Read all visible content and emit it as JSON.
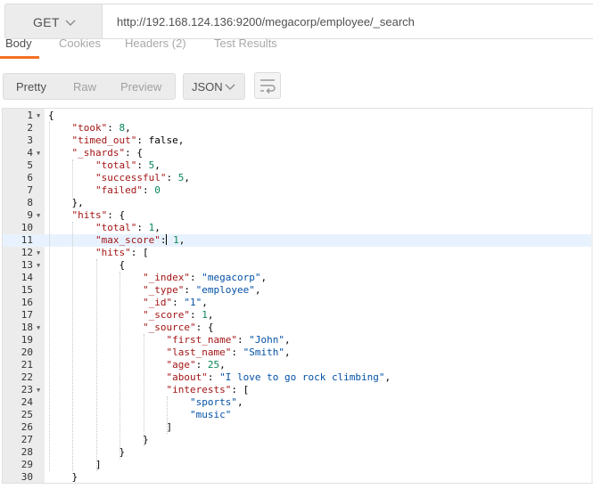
{
  "request": {
    "method": "GET",
    "url": "http://192.168.124.136:9200/megacorp/employee/_search"
  },
  "tabs": [
    {
      "label": "Body"
    },
    {
      "label": "Cookies"
    },
    {
      "label": "Headers (2)"
    },
    {
      "label": "Test Results"
    }
  ],
  "toolbar": {
    "views": [
      "Pretty",
      "Raw",
      "Preview"
    ],
    "format": "JSON",
    "wrap_icon": "wrap-lines-icon"
  },
  "colors": {
    "accent": "#f47023",
    "key": "#a31515",
    "string": "#0451a5",
    "number": "#098658",
    "highlight_line": "#e8f2fe"
  },
  "editor": {
    "highlighted_line": 11,
    "lines": [
      {
        "n": "1",
        "fold": true,
        "text": "{"
      },
      {
        "n": "2",
        "text": "    \"took\": 8,"
      },
      {
        "n": "3",
        "text": "    \"timed_out\": false,"
      },
      {
        "n": "4",
        "fold": true,
        "text": "    \"_shards\": {"
      },
      {
        "n": "5",
        "text": "        \"total\": 5,"
      },
      {
        "n": "6",
        "text": "        \"successful\": 5,"
      },
      {
        "n": "7",
        "text": "        \"failed\": 0"
      },
      {
        "n": "8",
        "text": "    },"
      },
      {
        "n": "9",
        "fold": true,
        "text": "    \"hits\": {"
      },
      {
        "n": "10",
        "text": "        \"total\": 1,"
      },
      {
        "n": "11",
        "text": "        \"max_score\": 1,"
      },
      {
        "n": "12",
        "fold": true,
        "text": "        \"hits\": ["
      },
      {
        "n": "13",
        "fold": true,
        "text": "            {"
      },
      {
        "n": "14",
        "text": "                \"_index\": \"megacorp\","
      },
      {
        "n": "15",
        "text": "                \"_type\": \"employee\","
      },
      {
        "n": "16",
        "text": "                \"_id\": \"1\","
      },
      {
        "n": "17",
        "text": "                \"_score\": 1,"
      },
      {
        "n": "18",
        "fold": true,
        "text": "                \"_source\": {"
      },
      {
        "n": "19",
        "text": "                    \"first_name\": \"John\","
      },
      {
        "n": "20",
        "text": "                    \"last_name\": \"Smith\","
      },
      {
        "n": "21",
        "text": "                    \"age\": 25,"
      },
      {
        "n": "22",
        "text": "                    \"about\": \"I love to go rock climbing\","
      },
      {
        "n": "23",
        "fold": true,
        "text": "                    \"interests\": ["
      },
      {
        "n": "24",
        "text": "                        \"sports\","
      },
      {
        "n": "25",
        "text": "                        \"music\""
      },
      {
        "n": "26",
        "text": "                    ]"
      },
      {
        "n": "27",
        "text": "                }"
      },
      {
        "n": "28",
        "text": "            }"
      },
      {
        "n": "29",
        "text": "        ]"
      },
      {
        "n": "30",
        "text": "    }"
      }
    ]
  }
}
